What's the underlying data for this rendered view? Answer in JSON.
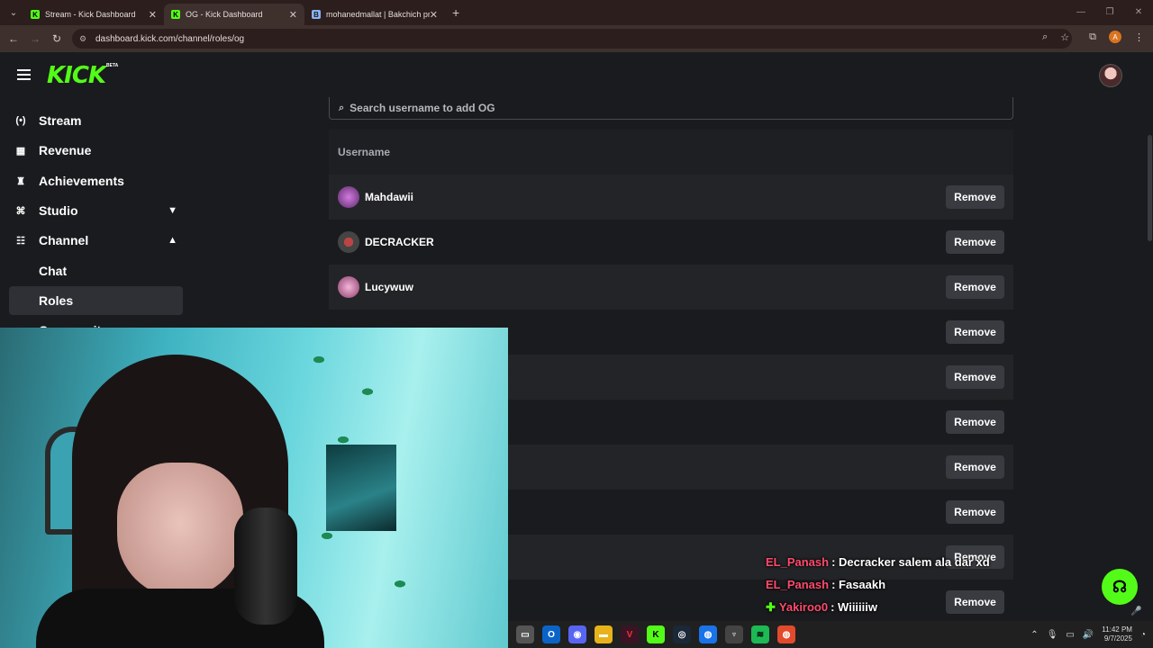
{
  "browser": {
    "tabs": [
      {
        "title": "Stream - Kick Dashboard",
        "active": false,
        "favicon": "kick-icon"
      },
      {
        "title": "OG - Kick Dashboard",
        "active": true,
        "favicon": "kick-icon"
      },
      {
        "title": "mohanedmallat | Bakchich profil",
        "active": false,
        "favicon": "document-icon"
      }
    ],
    "new_tab": "+",
    "url": "dashboard.kick.com/channel/roles/og",
    "profile_initial": "A"
  },
  "header": {
    "logo": "KICK",
    "badge": "BETA"
  },
  "sidebar": {
    "items": [
      {
        "label": "Stream",
        "icon": "broadcast-icon"
      },
      {
        "label": "Revenue",
        "icon": "revenue-icon"
      },
      {
        "label": "Achievements",
        "icon": "trophy-icon"
      },
      {
        "label": "Studio",
        "icon": "studio-icon",
        "chevron": "down"
      },
      {
        "label": "Channel",
        "icon": "channel-icon",
        "chevron": "up"
      },
      {
        "label": "Chat",
        "sub": true
      },
      {
        "label": "Roles",
        "sub": true,
        "active": true
      },
      {
        "label": "Community",
        "sub": true
      }
    ]
  },
  "main": {
    "search_placeholder": "Search username to add OG",
    "column_header": "Username",
    "remove_label": "Remove",
    "rows": [
      {
        "username": "Mahdawii"
      },
      {
        "username": "DECRACKER"
      },
      {
        "username": "Lucywuw"
      },
      {
        "username": ""
      },
      {
        "username": ""
      },
      {
        "username": ""
      },
      {
        "username": ""
      },
      {
        "username": ""
      },
      {
        "username": ""
      },
      {
        "username": ""
      }
    ]
  },
  "chat": {
    "messages": [
      {
        "user": "EL_Panash",
        "text": ": Decracker salem ala dar xd"
      },
      {
        "user": "EL_Panash",
        "text": ": Fasaakh"
      },
      {
        "user": "Yakiroo0",
        "text": ": Wiiiiiiw"
      }
    ]
  },
  "taskbar": {
    "time": "11:42 PM",
    "date": "9/7/2025"
  },
  "colors": {
    "accent": "#53fc18",
    "background": "#1a1b1e",
    "row_alt": "#232427",
    "button": "#3a3b40"
  }
}
